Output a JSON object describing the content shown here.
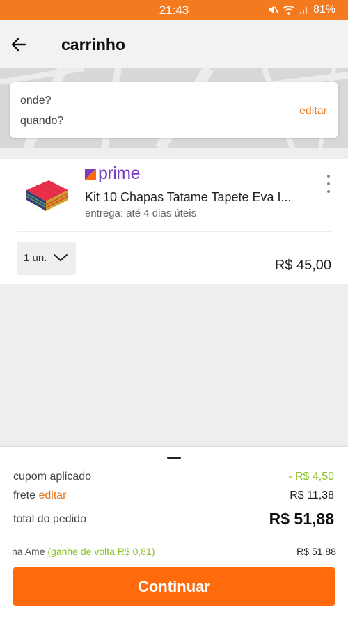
{
  "status_bar": {
    "time": "21:43",
    "battery": "81%"
  },
  "header": {
    "title": "carrinho"
  },
  "location": {
    "where": "onde?",
    "when": "quando?",
    "edit": "editar"
  },
  "cart_item": {
    "badge": "prime",
    "title": "Kit 10 Chapas Tatame Tapete Eva I...",
    "delivery": "entrega: até 4 dias úteis",
    "quantity": "1 un.",
    "price": "R$ 45,00"
  },
  "summary": {
    "coupon_label": "cupom aplicado",
    "coupon_value": "- R$ 4,50",
    "shipping_label": "frete",
    "shipping_edit": "editar",
    "shipping_value": "R$ 11,38",
    "total_label": "total do pedido",
    "total_value": "R$ 51,88",
    "ame_label": "na Ame",
    "ame_cashback": "(ganhe de volta R$ 0,81)",
    "ame_value": "R$ 51,88",
    "continue": "Continuar"
  },
  "colors": {
    "brand_orange": "#f47a20",
    "button_orange": "#ff6a0d",
    "prime_purple": "#7a3dc2",
    "discount_green": "#8bbf1f"
  }
}
